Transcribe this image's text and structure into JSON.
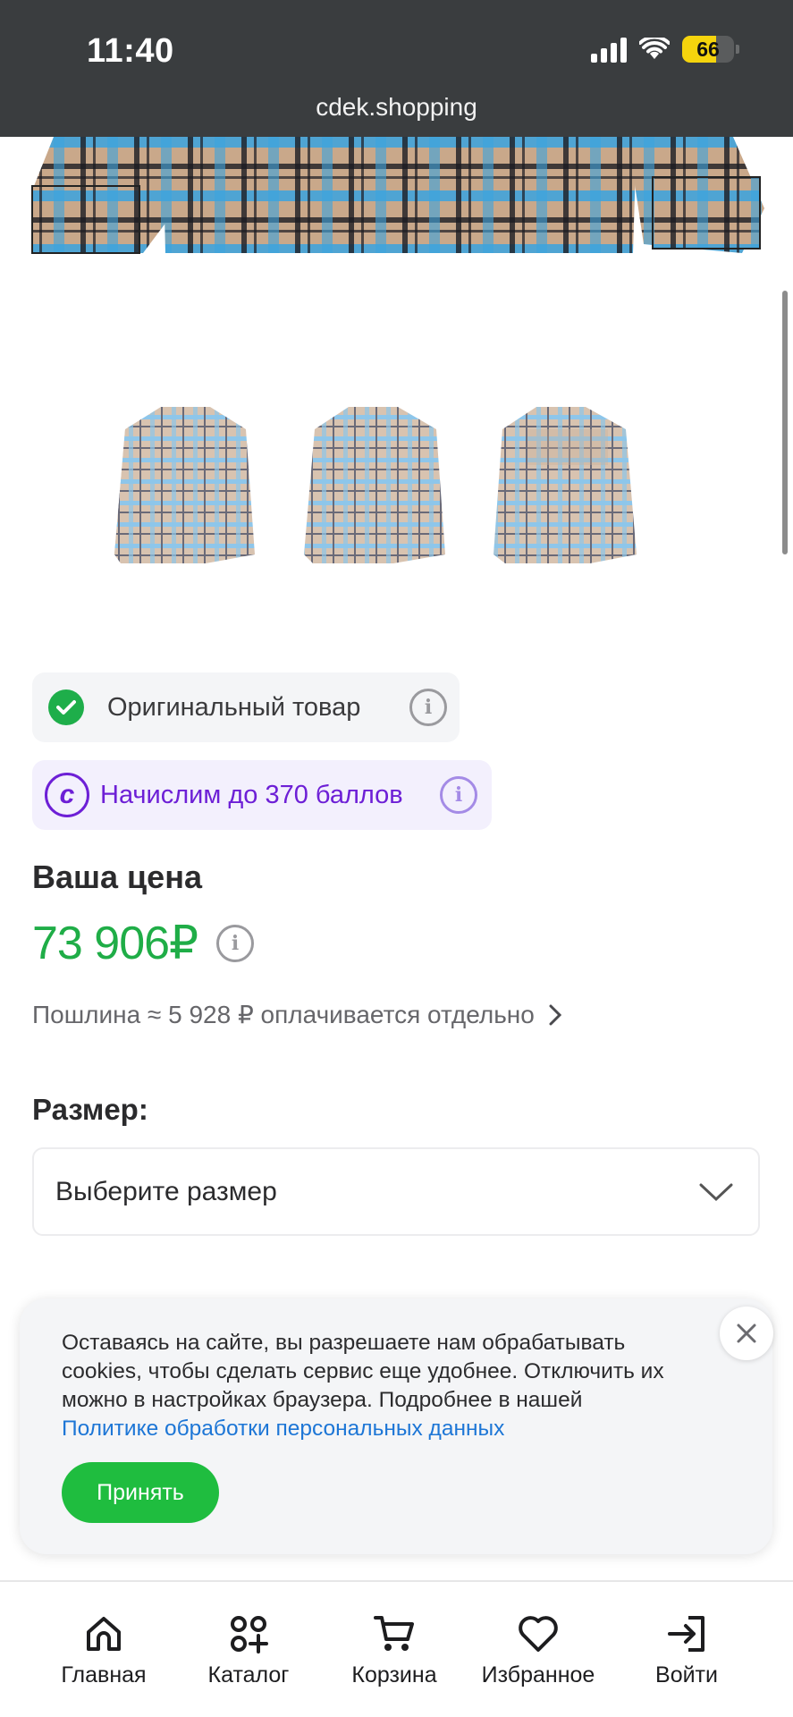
{
  "status_bar": {
    "time": "11:40",
    "battery": "66"
  },
  "browser": {
    "url": "cdek.shopping"
  },
  "badges": {
    "original": "Оригинальный товар",
    "bonus": "Начислим до 370 баллов"
  },
  "price": {
    "label": "Ваша цена",
    "value": "73 906₽",
    "duty": "Пошлина ≈ 5 928 ₽ оплачивается отдельно"
  },
  "size": {
    "label": "Размер:",
    "placeholder": "Выберите размер"
  },
  "cookie": {
    "text": "Оставаясь на сайте, вы разрешаете нам обрабатывать cookies, чтобы сделать сервис еще удобнее. Отключить их можно в настройках браузера. Подробнее в нашей",
    "link": "Политике обработки персональных данных",
    "accept": "Принять"
  },
  "nav": [
    {
      "label": "Главная",
      "icon": "home-icon"
    },
    {
      "label": "Каталог",
      "icon": "catalog-icon"
    },
    {
      "label": "Корзина",
      "icon": "cart-icon"
    },
    {
      "label": "Избранное",
      "icon": "heart-icon"
    },
    {
      "label": "Войти",
      "icon": "login-icon"
    }
  ],
  "colors": {
    "accent": "#1fbd3f",
    "price": "#1fad47",
    "bonus": "#6d1fd6",
    "link": "#1d76d6"
  }
}
